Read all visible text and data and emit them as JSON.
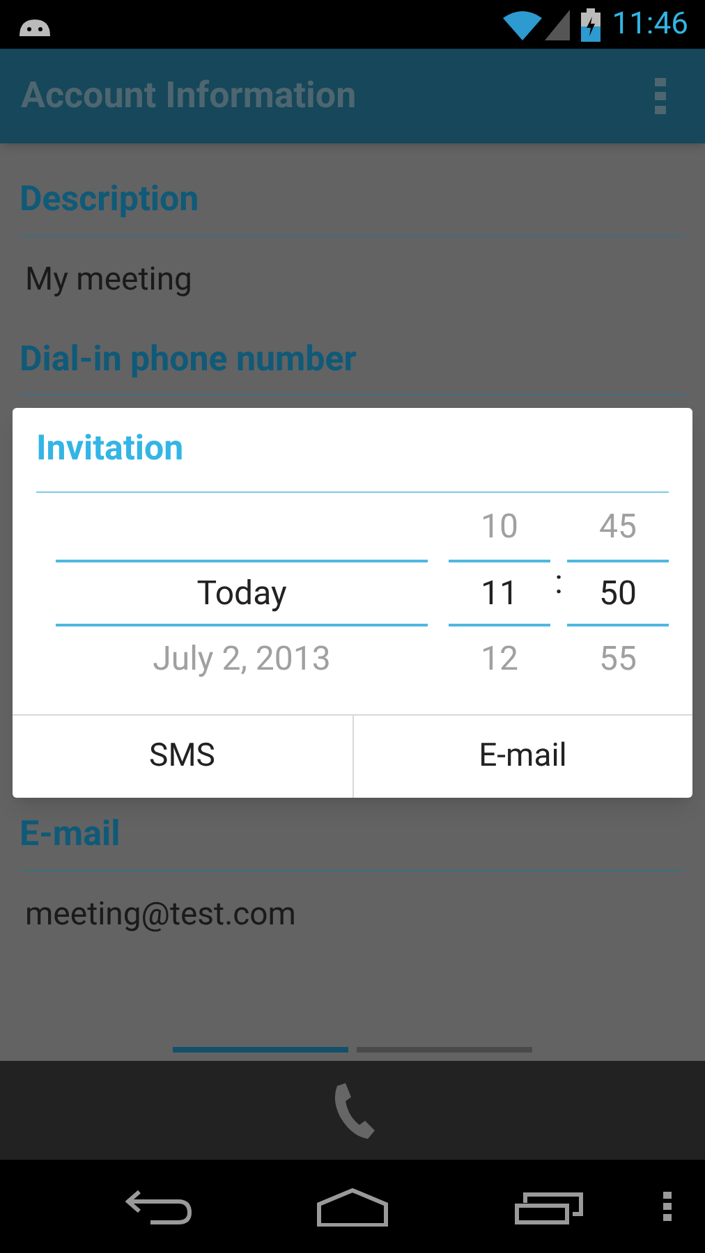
{
  "status_bar": {
    "time": "11:46"
  },
  "action_bar": {
    "title": "Account Information"
  },
  "sections": [
    {
      "title": "Description",
      "value": "My meeting"
    },
    {
      "title": "Dial-in phone number"
    },
    {
      "title": "E-mail",
      "value": "meeting@test.com"
    }
  ],
  "page_indicator": [
    {
      "selected": true
    },
    {
      "selected": false
    }
  ],
  "dialog": {
    "title": "Invitation",
    "date": {
      "selected": "Today",
      "below": "July 2, 2013"
    },
    "hour": {
      "above": "10",
      "selected": "11",
      "below": "12"
    },
    "separator": ":",
    "minute": {
      "above": "45",
      "selected": "50",
      "below": "55"
    },
    "buttons": [
      "SMS",
      "E-mail"
    ]
  }
}
